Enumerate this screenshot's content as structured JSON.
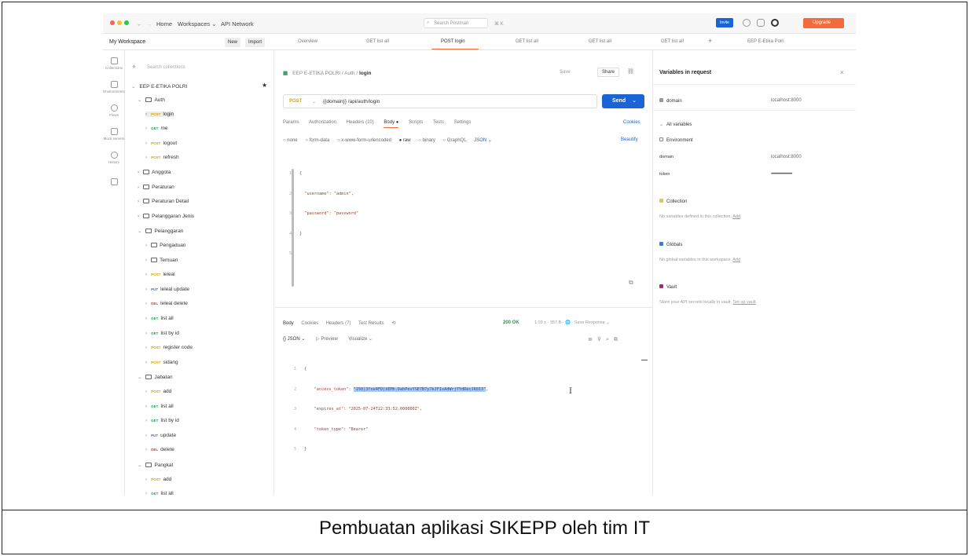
{
  "titlebar": {
    "nav_home": "Home",
    "nav_workspaces": "Workspaces ⌄",
    "nav_api_network": "API Network",
    "search_placeholder": "Search Postman",
    "search_shortcut": "⌘ K",
    "invite_label": "Invite",
    "upgrade_label": "Upgrade"
  },
  "workspace": {
    "name": "My Workspace",
    "new_label": "New",
    "import_label": "Import"
  },
  "tabs": [
    {
      "label": "Overview"
    },
    {
      "label": "GET list all"
    },
    {
      "label": "POST login"
    },
    {
      "label": "GET list all"
    },
    {
      "label": "GET list all"
    },
    {
      "label": "GET list all"
    },
    {
      "label": "EEP E-Etika Polri"
    }
  ],
  "rail": [
    {
      "label": "Collections"
    },
    {
      "label": "Environments"
    },
    {
      "label": "Flows"
    },
    {
      "label": "Mock servers"
    },
    {
      "label": "History"
    },
    {
      "label": ""
    }
  ],
  "sidebar": {
    "search_placeholder": "Search collections",
    "collection": "EEP E-ETIKA POLRI",
    "items": [
      {
        "chev": "⌄",
        "folder": true,
        "label": "Auth"
      },
      {
        "chev": "›",
        "method": "POST",
        "label": "login"
      },
      {
        "chev": "›",
        "method": "GET",
        "label": "me"
      },
      {
        "chev": "›",
        "method": "POST",
        "label": "logout"
      },
      {
        "chev": "›",
        "method": "POST",
        "label": "refresh"
      },
      {
        "chev": "›",
        "folder": true,
        "label": "Anggota"
      },
      {
        "chev": "›",
        "folder": true,
        "label": "Peraturan"
      },
      {
        "chev": "›",
        "folder": true,
        "label": "Peraturan Detail"
      },
      {
        "chev": "›",
        "folder": true,
        "label": "Pelanggaran Jenis"
      },
      {
        "chev": "⌄",
        "folder": true,
        "label": "Pelanggaran"
      },
      {
        "chev": "›",
        "folder": true,
        "label": "Pengaduan"
      },
      {
        "chev": "›",
        "folder": true,
        "label": "Temuan"
      },
      {
        "chev": "›",
        "method": "POST",
        "label": "leleal"
      },
      {
        "chev": "›",
        "method": "PUT",
        "label": "leleal update"
      },
      {
        "chev": "›",
        "method": "DEL",
        "label": "leleal delete"
      },
      {
        "chev": "›",
        "method": "GET",
        "label": "list all"
      },
      {
        "chev": "›",
        "method": "GET",
        "label": "list by id"
      },
      {
        "chev": "›",
        "method": "POST",
        "label": "register code"
      },
      {
        "chev": "›",
        "method": "POST",
        "label": "sidang"
      },
      {
        "chev": "⌄",
        "folder": true,
        "label": "Jabatan"
      },
      {
        "chev": "›",
        "method": "POST",
        "label": "add"
      },
      {
        "chev": "›",
        "method": "GET",
        "label": "list all"
      },
      {
        "chev": "›",
        "method": "GET",
        "label": "list by id"
      },
      {
        "chev": "›",
        "method": "PUT",
        "label": "update"
      },
      {
        "chev": "›",
        "method": "DEL",
        "label": "delete"
      },
      {
        "chev": "⌄",
        "folder": true,
        "label": "Pangkat"
      },
      {
        "chev": "›",
        "method": "POST",
        "label": "add"
      },
      {
        "chev": "›",
        "method": "GET",
        "label": "list all"
      }
    ]
  },
  "request": {
    "breadcrumb_collection": "EEP E-ETIKA POLRI",
    "breadcrumb_folder": "Auth",
    "breadcrumb_name": "login",
    "save_label": "Save",
    "share_label": "Share",
    "method": "POST",
    "url": "{{domain}} /api/auth/login",
    "send_label": "Send",
    "subtabs": [
      "Params",
      "Authorization",
      "Headers (10)",
      "Body ●",
      "Scripts",
      "Tests",
      "Settings"
    ],
    "cookies_label": "Cookies",
    "body_options": [
      "○ none",
      "○ form-data",
      "○ x-www-form-urlencoded",
      "● raw",
      "○ binary",
      "○ GraphQL",
      "JSON ⌄"
    ],
    "beautify_label": "Beautify",
    "body_lines": [
      "{",
      "  \"username\": \"admin\",",
      "  \"password\": \"password\"",
      "}",
      ""
    ]
  },
  "response": {
    "tabs": [
      "Body",
      "Cookies",
      "Headers (7)",
      "Test Results",
      "⟲"
    ],
    "status": "200 OK",
    "meta": "1.03 s · 357 B · 🌐 · Save Response ⌄",
    "view_options": [
      "{} JSON ⌄",
      "▷ Preview",
      "Visualize ⌄"
    ],
    "lines": [
      {
        "n": "1",
        "text": "{"
      },
      {
        "n": "2",
        "key": "\"access_token\"",
        "value": "\"150|3fxe4FD|kEMh.DahPevYSE7B7y7kJF1sAdWrjYYdRecJR0I3\""
      },
      {
        "n": "3",
        "key": "\"expires_at\"",
        "value": "\"2025-07-24T22:33:52.000000Z\""
      },
      {
        "n": "4",
        "key": "\"token_type\"",
        "value": "\"Bearer\""
      },
      {
        "n": "5",
        "text": "}"
      }
    ]
  },
  "variables": {
    "title": "Variables in request",
    "domain_key": "domain",
    "domain_value": "localhost:8000",
    "all_variables": "All variables",
    "environment": "Environment",
    "env_domain_key": "domain",
    "env_domain_value": "localhost:8000",
    "env_token_key": "token",
    "env_token_value": "••••••••••••••••••••••••",
    "collection": "Collection",
    "collection_note": "No variables defined in this collection.",
    "collection_add": "Add",
    "globals": "Globals",
    "globals_note": "No global variables in this workspace.",
    "globals_add": "Add",
    "vault": "Vault",
    "vault_note": "Store your API secrets locally in vault.",
    "vault_link": "Set up vault"
  },
  "caption": "Pembuatan aplikasi SIKEPP oleh tim IT",
  "colors": {
    "accent": "#1b64d6",
    "upgrade": "#f26b3a",
    "post": "#d7a500",
    "get": "#2f9a56",
    "highlight": "#a9c9f5"
  }
}
